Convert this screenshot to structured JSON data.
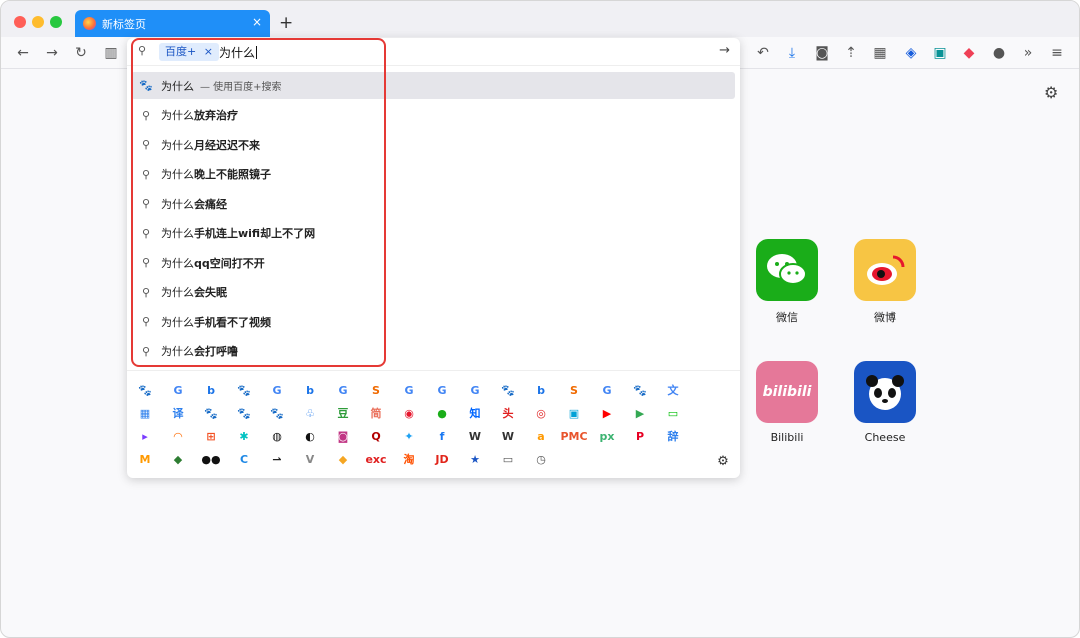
{
  "tab": {
    "title": "新标签页",
    "close": "×"
  },
  "newtab": "+",
  "nav": {
    "back": "←",
    "forward": "→",
    "reload": "↻",
    "sidebar": "▥"
  },
  "urlbar": {
    "engine_chip": "百度+",
    "chip_close": "×",
    "query": "为什么",
    "go": "→"
  },
  "suggestions": [
    {
      "prefix": "为什么",
      "bold": "",
      "hint": "— 使用百度+搜索",
      "icon": "baidu-icon"
    },
    {
      "prefix": "为什么",
      "bold": "放弃治疗",
      "hint": "",
      "icon": "search-icon"
    },
    {
      "prefix": "为什么",
      "bold": "月经迟迟不来",
      "hint": "",
      "icon": "search-icon"
    },
    {
      "prefix": "为什么",
      "bold": "晚上不能照镜子",
      "hint": "",
      "icon": "search-icon"
    },
    {
      "prefix": "为什么",
      "bold": "会痛经",
      "hint": "",
      "icon": "search-icon"
    },
    {
      "prefix": "为什么",
      "bold": "手机连上wifi却上不了网",
      "hint": "",
      "icon": "search-icon"
    },
    {
      "prefix": "为什么",
      "bold": "qq空间打不开",
      "hint": "",
      "icon": "search-icon"
    },
    {
      "prefix": "为什么",
      "bold": "会失眠",
      "hint": "",
      "icon": "search-icon"
    },
    {
      "prefix": "为什么",
      "bold": "手机看不了视频",
      "hint": "",
      "icon": "search-icon"
    },
    {
      "prefix": "为什么",
      "bold": "会打呼噜",
      "hint": "",
      "icon": "search-icon"
    }
  ],
  "engine_rows": [
    [
      {
        "g": "🐾",
        "c": "#3b5bdb"
      },
      {
        "g": "G",
        "c": "#4285f4"
      },
      {
        "g": "b",
        "c": "#1a73e8"
      },
      {
        "g": "🐾",
        "c": "#3b5bdb"
      },
      {
        "g": "G",
        "c": "#4285f4"
      },
      {
        "g": "b",
        "c": "#1a73e8"
      },
      {
        "g": "G",
        "c": "#4285f4"
      },
      {
        "g": "S",
        "c": "#f06a00"
      },
      {
        "g": "G",
        "c": "#4285f4"
      },
      {
        "g": "G",
        "c": "#4285f4"
      },
      {
        "g": "G",
        "c": "#4285f4"
      },
      {
        "g": "🐾",
        "c": "#3b5bdb"
      },
      {
        "g": "b",
        "c": "#1a73e8"
      },
      {
        "g": "S",
        "c": "#f06a00"
      },
      {
        "g": "G",
        "c": "#4285f4"
      },
      {
        "g": "🐾",
        "c": "#3b5bdb"
      },
      {
        "g": "文",
        "c": "#4285f4"
      }
    ],
    [
      {
        "g": "▦",
        "c": "#2f80ed"
      },
      {
        "g": "译",
        "c": "#2f80ed"
      },
      {
        "g": "🐾",
        "c": "#3b5bdb"
      },
      {
        "g": "🐾",
        "c": "#3b5bdb"
      },
      {
        "g": "🐾",
        "c": "#3b5bdb"
      },
      {
        "g": "♧",
        "c": "#2f80ed"
      },
      {
        "g": "豆",
        "c": "#2e9c3a"
      },
      {
        "g": "简",
        "c": "#ea6f5a"
      },
      {
        "g": "◉",
        "c": "#e6162d"
      },
      {
        "g": "●",
        "c": "#1aad19"
      },
      {
        "g": "知",
        "c": "#0066ff"
      },
      {
        "g": "头",
        "c": "#e02020"
      },
      {
        "g": "◎",
        "c": "#e02020"
      },
      {
        "g": "▣",
        "c": "#00a1d6"
      },
      {
        "g": "▶",
        "c": "#ff0000"
      },
      {
        "g": "▶",
        "c": "#34a853"
      },
      {
        "g": "▭",
        "c": "#00be06"
      }
    ],
    [
      {
        "g": "▸",
        "c": "#7a3cff"
      },
      {
        "g": "◠",
        "c": "#ff6a00"
      },
      {
        "g": "⊞",
        "c": "#f25022"
      },
      {
        "g": "✱",
        "c": "#00c2c2"
      },
      {
        "g": "◍",
        "c": "#111111"
      },
      {
        "g": "◐",
        "c": "#111111"
      },
      {
        "g": "◙",
        "c": "#c13584"
      },
      {
        "g": "Q",
        "c": "#b20000"
      },
      {
        "g": "✦",
        "c": "#1da1f2"
      },
      {
        "g": "f",
        "c": "#1877f2"
      },
      {
        "g": "W",
        "c": "#333333"
      },
      {
        "g": "W",
        "c": "#333333"
      },
      {
        "g": "a",
        "c": "#ff9900"
      },
      {
        "g": "PMC",
        "c": "#e8542c"
      },
      {
        "g": "px",
        "c": "#3cb371"
      },
      {
        "g": "P",
        "c": "#e60023"
      },
      {
        "g": "辞",
        "c": "#2f80ed"
      }
    ],
    [
      {
        "g": "M",
        "c": "#ff9900"
      },
      {
        "g": "◆",
        "c": "#2e7d32"
      },
      {
        "g": "●●",
        "c": "#111111"
      },
      {
        "g": "C",
        "c": "#1e88e5"
      },
      {
        "g": "⇀",
        "c": "#222222"
      },
      {
        "g": "V",
        "c": "#888888"
      },
      {
        "g": "◆",
        "c": "#f5a623"
      },
      {
        "g": "exc",
        "c": "#e02020"
      },
      {
        "g": "淘",
        "c": "#ff5000"
      },
      {
        "g": "JD",
        "c": "#e1251b"
      },
      {
        "g": "★",
        "c": "#1a55c4"
      },
      {
        "g": "▭",
        "c": "#555555"
      },
      {
        "g": "◷",
        "c": "#555555"
      }
    ]
  ],
  "sites": [
    {
      "name": "微信",
      "color": "#1aad19",
      "glyph": "💬"
    },
    {
      "name": "微博",
      "color": "#f5a623",
      "glyph": "◉"
    },
    {
      "name": "Bilibili",
      "color": "#e57899",
      "glyph": "bilibili"
    },
    {
      "name": "Cheese",
      "color": "#1a55c4",
      "glyph": "🐼"
    }
  ]
}
